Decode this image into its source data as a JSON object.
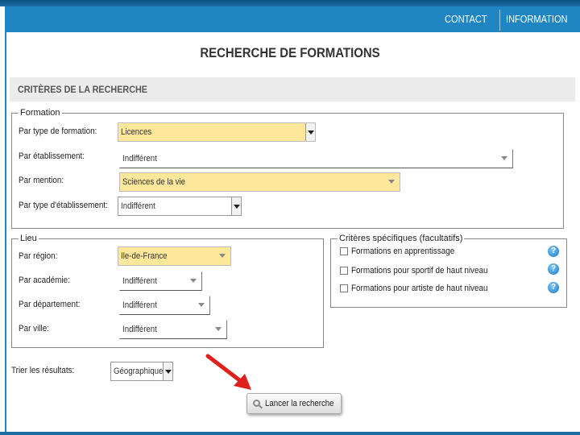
{
  "nav": {
    "contact": "CONTACT",
    "information": "INFORMATION"
  },
  "page_title": "RECHERCHE DE FORMATIONS",
  "criteria_title": "CRITÈRES DE LA RECHERCHE",
  "formation": {
    "legend": "Formation",
    "type_label": "Par type de formation:",
    "type_value": "Licences",
    "etab_label": "Par établissement:",
    "etab_value": "Indifférent",
    "mention_label": "Par mention:",
    "mention_value": "Sciences de la vie",
    "type_etab_label": "Par type d'établissement:",
    "type_etab_value": "Indifférent"
  },
  "lieu": {
    "legend": "Lieu",
    "region_label": "Par région:",
    "region_value": "Ile-de-France",
    "academie_label": "Par académie:",
    "academie_value": "Indifférent",
    "departement_label": "Par département:",
    "departement_value": "Indifférent",
    "ville_label": "Par ville:",
    "ville_value": "Indifférent"
  },
  "specific": {
    "legend": "Critères spécifiques (facultatifs)",
    "options": [
      "Formations en apprentissage",
      "Formations pour sportif de haut niveau",
      "Formations pour artiste de haut niveau"
    ],
    "help_glyph": "?"
  },
  "sort": {
    "label": "Trier les résultats:",
    "value": "Géographique"
  },
  "launch_button": "Lancer la recherche",
  "colors": {
    "nav_blue": "#1f86c3",
    "highlight_yellow": "#fce79a",
    "arrow_red": "#e0201b"
  }
}
